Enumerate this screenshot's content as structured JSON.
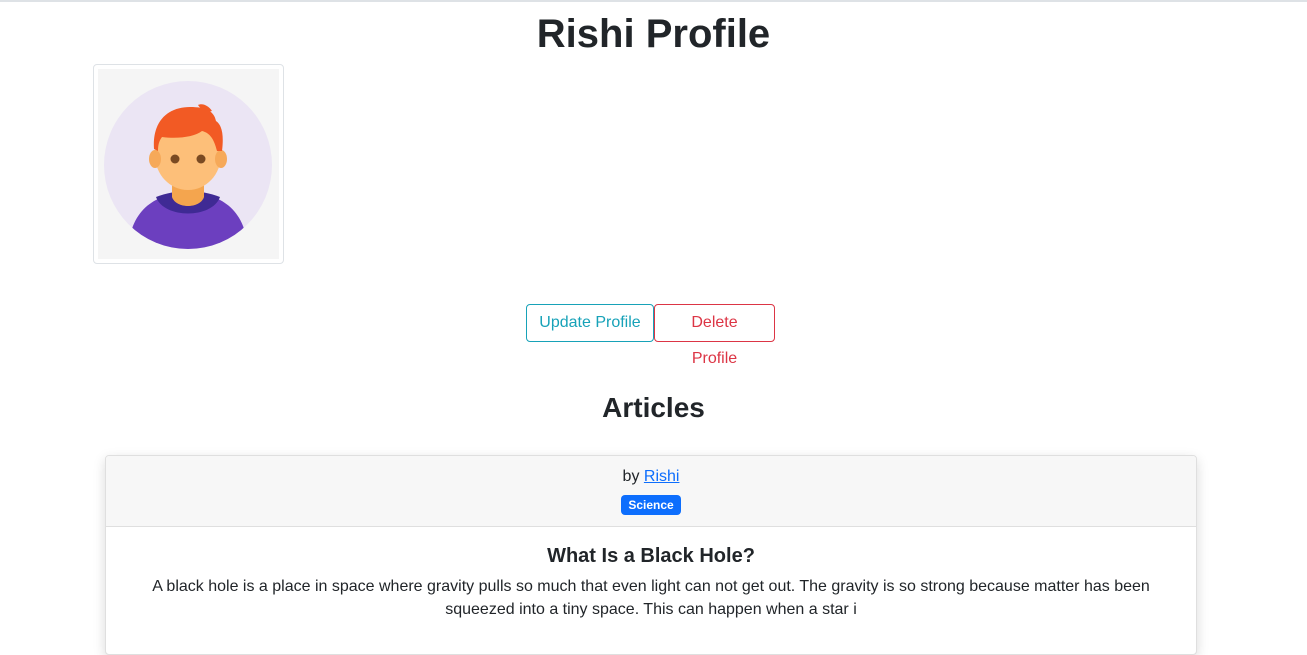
{
  "page": {
    "title": "Rishi Profile"
  },
  "avatar": {
    "icon": "user-avatar-icon",
    "colors": {
      "background": "#f5f5f5",
      "circle": "#ebe5f4",
      "hair": "#f25a24",
      "skin": "#fdbf79",
      "shirt": "#6c3fbf",
      "collar": "#3f2a94"
    }
  },
  "actions": {
    "update_label": "Update Profile",
    "delete_label": "Delete Profile"
  },
  "articles": {
    "heading": "Articles",
    "items": [
      {
        "by_prefix": "by",
        "author": "Rishi",
        "category": "Science",
        "title": "What Is a Black Hole?",
        "excerpt": "A black hole is a place in space where gravity pulls so much that even light can not get out. The gravity is so strong because matter has been squeezed into a tiny space. This can happen when a star i"
      }
    ]
  },
  "colors": {
    "info": "#17a2b8",
    "danger": "#dc3545",
    "primary": "#0d6efd"
  }
}
